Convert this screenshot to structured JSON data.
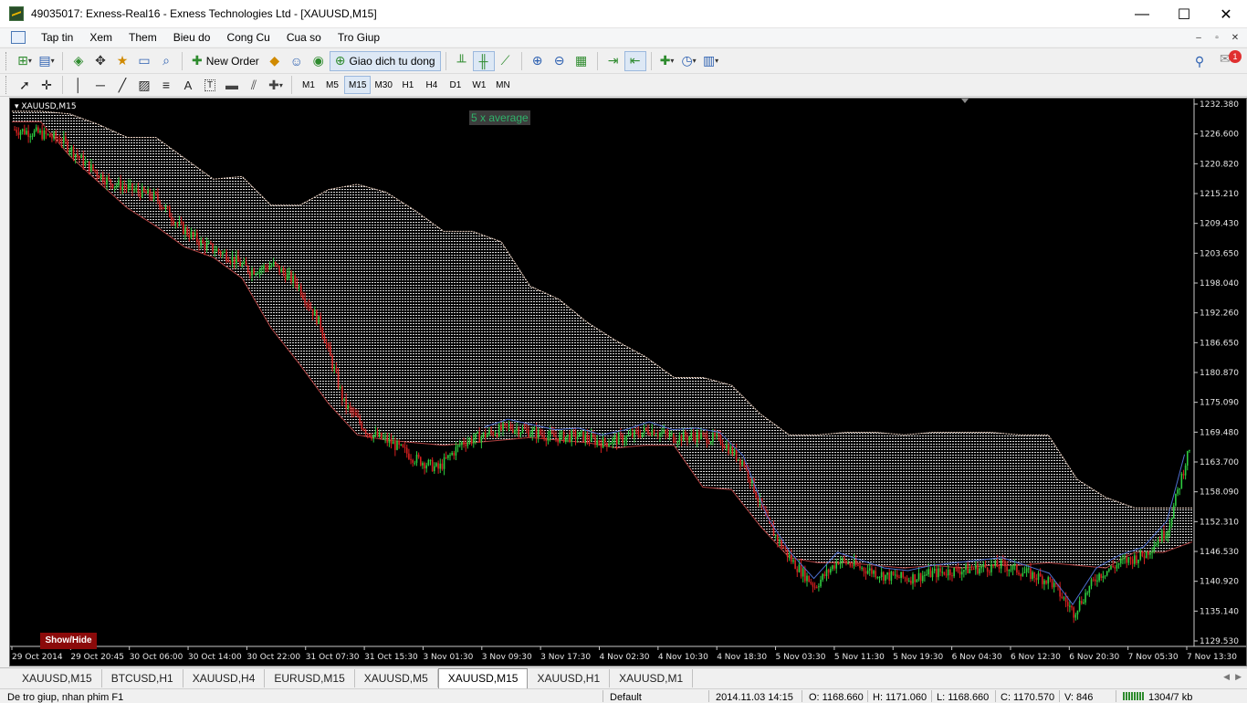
{
  "window": {
    "title": "49035017: Exness-Real16 - Exness Technologies Ltd - [XAUUSD,M15]",
    "minimize": "—",
    "maximize": "☐",
    "close": "✕"
  },
  "menu": {
    "items": [
      "Tap tin",
      "Xem",
      "Them",
      "Bieu do",
      "Cong Cu",
      "Cua so",
      "Tro Giup"
    ],
    "mdi_buttons": [
      "–",
      "▫",
      "✕"
    ]
  },
  "toolbar1": {
    "new_order": "New Order",
    "auto_trading": "Giao dich tu dong",
    "notification_count": "1"
  },
  "toolbar2": {
    "text_tool": "A",
    "label_tool": "T",
    "timeframes": [
      "M1",
      "M5",
      "M15",
      "M30",
      "H1",
      "H4",
      "D1",
      "W1",
      "MN"
    ],
    "active_timeframe": "M15"
  },
  "chart": {
    "symbol_label": "XAUUSD,M15",
    "indicator_label": "5 x average",
    "show_hide": "Show/Hide",
    "colors": {
      "background": "#000000",
      "bull": "#2ecc40",
      "bear": "#d62020",
      "cloud_upper": "#ffffff",
      "cloud_lower": "#e04040",
      "kijun": "#4f6fd0"
    }
  },
  "chart_data": {
    "type": "line",
    "title": "XAUUSD,M15",
    "price_ticks": [
      "1232.380",
      "1226.600",
      "1220.820",
      "1215.210",
      "1209.430",
      "1203.650",
      "1198.040",
      "1192.260",
      "1186.650",
      "1180.870",
      "1175.090",
      "1169.480",
      "1163.700",
      "1158.090",
      "1152.310",
      "1146.530",
      "1140.920",
      "1135.140",
      "1129.530"
    ],
    "time_ticks": [
      "29 Oct 2014",
      "29 Oct 20:45",
      "30 Oct 06:00",
      "30 Oct 14:00",
      "30 Oct 22:00",
      "31 Oct 07:30",
      "31 Oct 15:30",
      "3 Nov 01:30",
      "3 Nov 09:30",
      "3 Nov 17:30",
      "4 Nov 02:30",
      "4 Nov 10:30",
      "4 Nov 18:30",
      "5 Nov 03:30",
      "5 Nov 11:30",
      "5 Nov 19:30",
      "6 Nov 04:30",
      "6 Nov 12:30",
      "6 Nov 20:30",
      "7 Nov 05:30",
      "7 Nov 13:30"
    ],
    "ylim": [
      1129.53,
      1232.38
    ],
    "series": [
      {
        "name": "price",
        "values": [
          1227.5,
          1226.8,
          1225.5,
          1221.0,
          1217.5,
          1216.0,
          1214.5,
          1209.0,
          1205.5,
          1203.5,
          1200.5,
          1201.5,
          1198.0,
          1190.0,
          1175.0,
          1169.5,
          1167.5,
          1164.5,
          1162.5,
          1167.5,
          1169.0,
          1170.5,
          1169.5,
          1168.5,
          1168.8,
          1167.5,
          1168.5,
          1170.0,
          1168.5,
          1168.8,
          1168.0,
          1163.5,
          1152.0,
          1145.0,
          1140.0,
          1145.0,
          1143.5,
          1142.0,
          1141.5,
          1142.5,
          1143.0,
          1143.5,
          1144.0,
          1142.5,
          1141.0,
          1135.0,
          1142.0,
          1144.5,
          1146.0,
          1151.0,
          1168.0
        ]
      },
      {
        "name": "senkou_a",
        "values": [
          1231.0,
          1231.0,
          1230.5,
          1228.5,
          1226.0,
          1226.0,
          1222.0,
          1218.0,
          1218.5,
          1213.0,
          1213.0,
          1216.0,
          1217.0,
          1215.5,
          1212.0,
          1208.0,
          1208.0,
          1206.0,
          1197.5,
          1195.0,
          1190.5,
          1187.0,
          1184.0,
          1180.0,
          1180.0,
          1178.5,
          1173.0,
          1169.0,
          1169.0,
          1169.5,
          1169.5,
          1169.0,
          1169.5,
          1169.5,
          1169.5,
          1169.0,
          1169.0,
          1160.5,
          1157.0,
          1155.0,
          1155.0,
          1155.0
        ]
      },
      {
        "name": "senkou_b",
        "values": [
          1229.0,
          1229.0,
          1222.5,
          1217.5,
          1212.5,
          1209.0,
          1205.0,
          1203.0,
          1199.0,
          1189.5,
          1182.5,
          1175.0,
          1169.0,
          1168.0,
          1167.5,
          1167.0,
          1167.5,
          1168.0,
          1168.5,
          1168.0,
          1167.5,
          1166.5,
          1167.0,
          1167.0,
          1159.0,
          1158.5,
          1151.5,
          1145.5,
          1144.5,
          1144.5,
          1144.0,
          1143.5,
          1144.0,
          1143.5,
          1144.0,
          1144.0,
          1144.5,
          1144.0,
          1143.5,
          1146.5,
          1146.5,
          1148.5
        ]
      }
    ],
    "grid": false
  },
  "tabs": {
    "items": [
      "XAUUSD,M15",
      "BTCUSD,H1",
      "XAUUSD,H4",
      "EURUSD,M15",
      "XAUUSD,M5",
      "XAUUSD,M15",
      "XAUUSD,H1",
      "XAUUSD,M1"
    ],
    "active_index": 5
  },
  "status": {
    "help": "De tro giup, nhan phim F1",
    "profile": "Default",
    "datetime": "2014.11.03 14:15",
    "open": "O: 1168.660",
    "high": "H: 1171.060",
    "low": "L: 1168.660",
    "close": "C: 1170.570",
    "volume": "V: 846",
    "traffic": "1304/7 kb"
  }
}
